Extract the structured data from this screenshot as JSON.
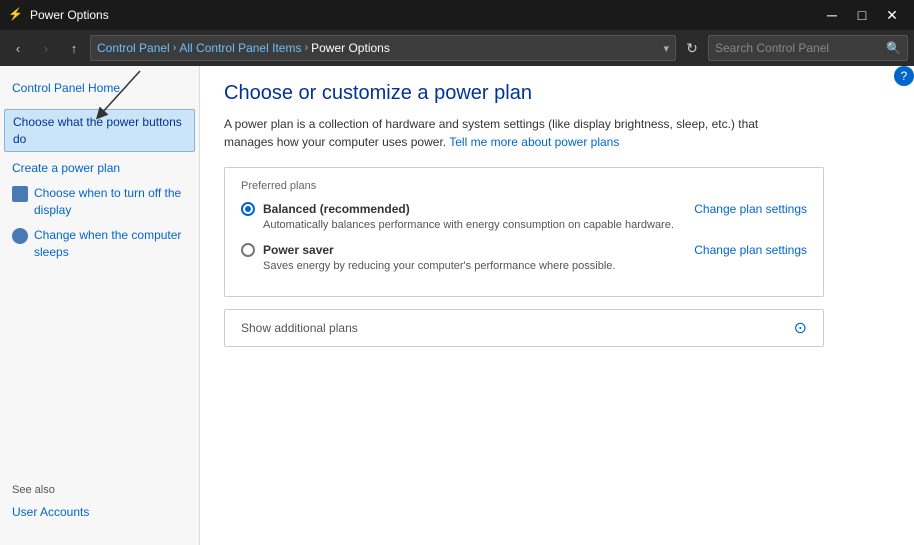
{
  "window": {
    "title": "Power Options",
    "icon": "⚡"
  },
  "titlebar": {
    "minimize": "─",
    "maximize": "□",
    "close": "✕"
  },
  "addressbar": {
    "back": "‹",
    "forward": "›",
    "up": "↑",
    "path": [
      {
        "label": "Control Panel",
        "type": "link"
      },
      {
        "label": "All Control Panel Items",
        "type": "link"
      },
      {
        "label": "Power Options",
        "type": "current"
      }
    ],
    "refresh": "↻",
    "search_placeholder": "Search Control Panel"
  },
  "sidebar": {
    "home_link": "Control Panel Home",
    "links": [
      {
        "label": "Choose what the power buttons do",
        "selected": true,
        "icon": false
      },
      {
        "label": "Create a power plan",
        "selected": false,
        "icon": false
      },
      {
        "label": "Choose when to turn off the display",
        "selected": false,
        "icon": true
      },
      {
        "label": "Change when the computer sleeps",
        "selected": false,
        "icon": true
      }
    ],
    "see_also": "See also",
    "see_also_links": [
      {
        "label": "User Accounts"
      }
    ]
  },
  "content": {
    "title": "Choose or customize a power plan",
    "description": "A power plan is a collection of hardware and system settings (like display brightness, sleep, etc.) that manages how your computer uses power.",
    "learn_more_link": "Tell me more about power plans",
    "preferred_plans_label": "Preferred plans",
    "plans": [
      {
        "name": "Balanced (recommended)",
        "description": "Automatically balances performance with energy consumption on capable hardware.",
        "selected": true,
        "change_link": "Change plan settings"
      },
      {
        "name": "Power saver",
        "description": "Saves energy by reducing your computer's performance where possible.",
        "selected": false,
        "change_link": "Change plan settings"
      }
    ],
    "show_additional": "Show additional plans",
    "annotation_arrow": "↓"
  }
}
